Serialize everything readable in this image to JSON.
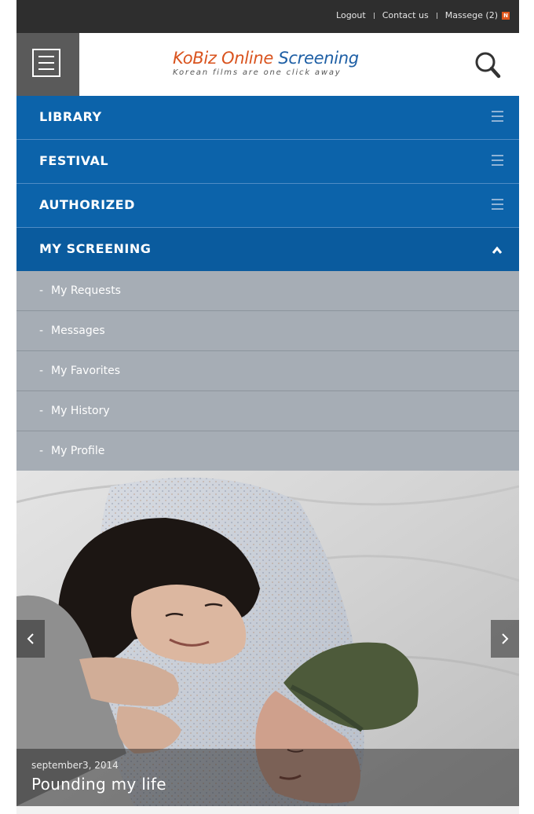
{
  "topbar": {
    "logout": "Logout",
    "contact": "Contact us",
    "messages": "Massege (2)",
    "new_badge": "N"
  },
  "header": {
    "logo_part1": "KoBiz",
    "logo_part2": "Online",
    "logo_part3": "Screening",
    "tagline": "Korean films are one click away",
    "menu_icon": "hamburger-box-icon",
    "search_icon": "search-icon"
  },
  "nav": {
    "items": [
      {
        "label": "LIBRARY",
        "icon": "hamburger-icon"
      },
      {
        "label": "FESTIVAL",
        "icon": "hamburger-icon"
      },
      {
        "label": "AUTHORIZED",
        "icon": "hamburger-icon"
      },
      {
        "label": "MY SCREENING",
        "icon": "chevron-up-icon"
      }
    ]
  },
  "submenu": {
    "bullet": "-",
    "items": [
      {
        "label": "My Requests"
      },
      {
        "label": "Messages"
      },
      {
        "label": "My Favorites"
      },
      {
        "label": "My History"
      },
      {
        "label": "My Profile"
      }
    ]
  },
  "slide": {
    "date": "september3, 2014",
    "title": "Pounding my life",
    "prev_icon": "chevron-left-icon",
    "next_icon": "chevron-right-icon"
  },
  "colors": {
    "nav_blue": "#0c63aa",
    "submenu_gray": "#a6adb5",
    "topbar_dark": "#2e2e2e",
    "logo_orange": "#d9531e",
    "logo_blue": "#1e5fa5"
  }
}
